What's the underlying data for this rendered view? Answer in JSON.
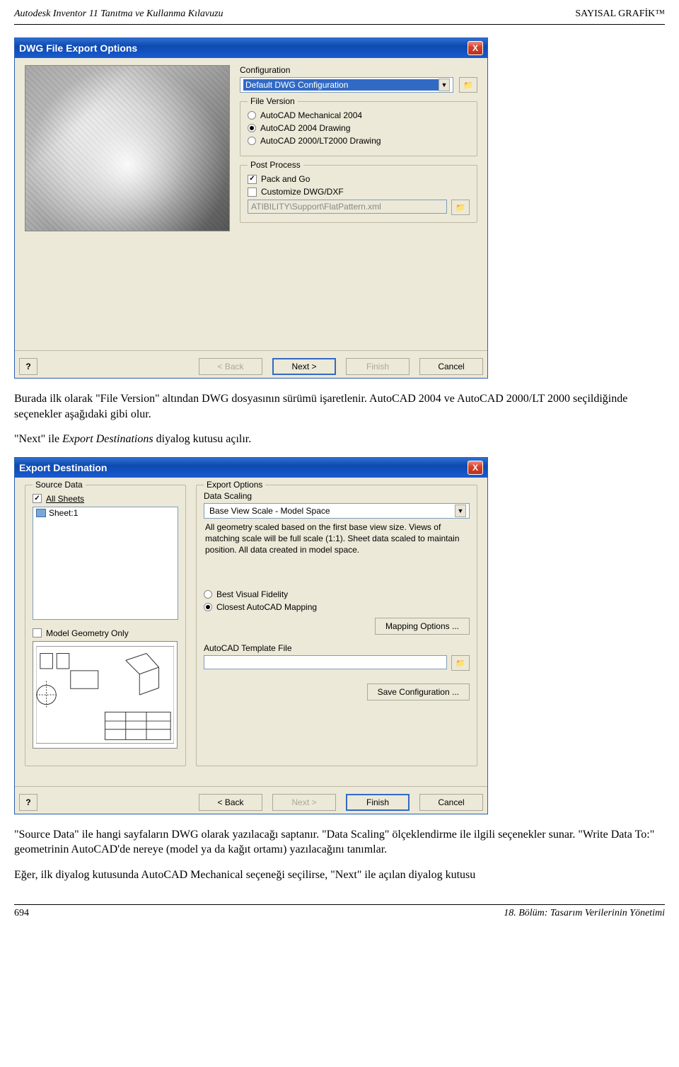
{
  "header": {
    "left": "Autodesk Inventor 11 Tanıtma ve Kullanma Kılavuzu",
    "right": "SAYISAL GRAFİK™"
  },
  "dialog1": {
    "title": "DWG File Export Options",
    "close": "X",
    "config_label": "Configuration",
    "config_value": "Default DWG Configuration",
    "file_version": {
      "legend": "File Version",
      "opt1": "AutoCAD Mechanical 2004",
      "opt2": "AutoCAD 2004 Drawing",
      "opt3": "AutoCAD 2000/LT2000 Drawing"
    },
    "post_process": {
      "legend": "Post Process",
      "pack": "Pack and Go",
      "customize": "Customize DWG/DXF",
      "path": "ATIBILITY\\Support\\FlatPattern.xml"
    },
    "help": "?",
    "back": "< Back",
    "next": "Next >",
    "finish": "Finish",
    "cancel": "Cancel"
  },
  "para1": "Burada ilk olarak \"File Version\" altından DWG dosyasının sürümü işaretlenir. AutoCAD 2004 ve AutoCAD 2000/LT 2000 seçildiğinde seçenekler aşağıdaki gibi olur.",
  "para2_a": "\"Next\" ile ",
  "para2_em": "Export Destinations",
  "para2_b": " diyalog kutusu açılır.",
  "dialog2": {
    "title": "Export Destination",
    "close": "X",
    "source": {
      "legend": "Source Data",
      "all_sheets": "All Sheets",
      "sheet1": "Sheet:1",
      "model_only": "Model Geometry Only"
    },
    "export": {
      "legend": "Export Options",
      "scaling_label": "Data Scaling",
      "scaling_value": "Base View Scale - Model Space",
      "desc": "All geometry scaled based on the first base view size. Views of matching scale will be full scale (1:1). Sheet data scaled to maintain position. All data created in model space.",
      "fidelity1": "Best Visual Fidelity",
      "fidelity2": "Closest AutoCAD Mapping",
      "mapping_btn": "Mapping Options ...",
      "template_label": "AutoCAD Template File",
      "save_config": "Save Configuration ..."
    },
    "help": "?",
    "back": "< Back",
    "next": "Next >",
    "finish": "Finish",
    "cancel": "Cancel"
  },
  "para3": "\"Source Data\" ile hangi sayfaların DWG olarak yazılacağı saptanır. \"Data Scaling\" ölçeklendirme ile ilgili seçenekler sunar. \"Write Data To:\" geometrinin AutoCAD'de nereye (model ya da kağıt ortamı) yazılacağını tanımlar.",
  "para4": "Eğer, ilk diyalog kutusunda AutoCAD Mechanical seçeneği seçilirse, \"Next\" ile açılan diyalog kutusu",
  "footer": {
    "page": "694",
    "chapter": "18. Bölüm: Tasarım Verilerinin Yönetimi"
  }
}
